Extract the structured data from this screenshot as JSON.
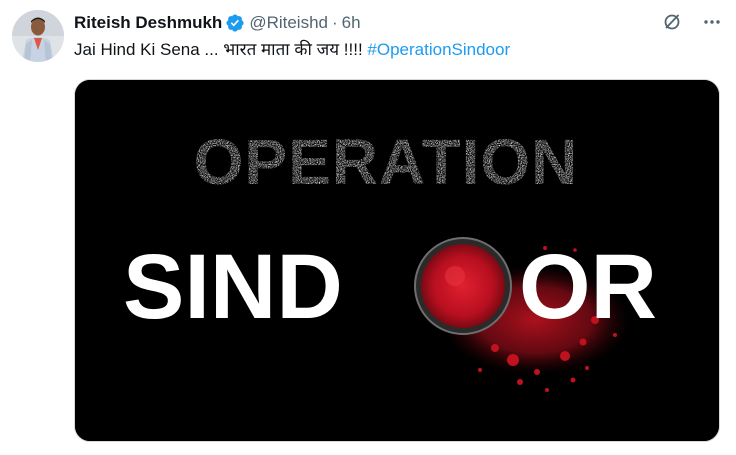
{
  "tweet": {
    "display_name": "Riteish Deshmukh",
    "handle": "@Riteishd",
    "separator": "·",
    "time": "6h",
    "text": "Jai Hind Ki Sena ... भारत माता की जय !!!! ",
    "hashtag": "#OperationSindoor"
  },
  "media": {
    "line1": "OPERATION",
    "line2_part1": "SIND",
    "line2_part2": "OR"
  },
  "icons": {
    "avatar": "profile-avatar",
    "verified": "verified-badge-icon",
    "grok": "grok-icon",
    "more": "more-icon"
  },
  "colors": {
    "accent": "#1d9bf0",
    "muted": "#536471",
    "text": "#0f1419",
    "sindoor_red": "#c8102e"
  }
}
